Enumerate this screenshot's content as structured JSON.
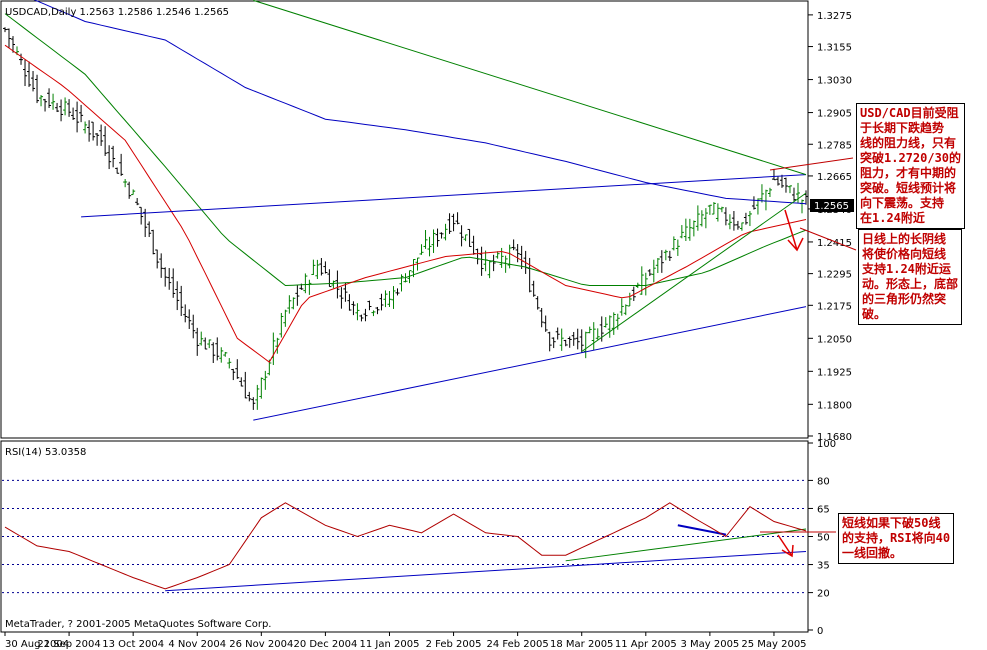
{
  "header": {
    "symbol_line": "USDCAD,Daily  1.2563 1.2586 1.2546 1.2565",
    "rsi_line": "RSI(14) 53.0358",
    "copyright": "MetaTrader, ? 2001-2005 MetaQuotes Software Corp."
  },
  "annotations": {
    "box1": "USD/CAD目前受阻\n于长期下跌趋势\n线的阻力线，只有\n突破1.2720/30的\n阻力，才有中期的\n突破。短线预计将\n向下震荡。支持\n在1.24附近",
    "box2": "日线上的长阴线\n将使价格向短线\n支持1.24附近运\n动。形态上，底部\n的三角形仍然突\n破。",
    "box3": "短线如果下破50线\n的支持，RSI将向40\n一线回撤。"
  },
  "colors": {
    "up_bar": "#008000",
    "down_bar": "#000000",
    "ma_fast": "#d40000",
    "ma_mid": "#008000",
    "ma_slow": "#0000c0",
    "trend_blue": "#0000c0",
    "trend_green": "#008000",
    "rsi_line": "#b00000",
    "arrow": "#e00000",
    "price_tag_bg": "#000000"
  },
  "chart_data": [
    {
      "type": "ohlc",
      "title": "USDCAD,Daily",
      "current_price": "1.2565",
      "ylim": [
        1.168,
        1.332
      ],
      "y_ticks": [
        "1.3275",
        "1.3155",
        "1.3030",
        "1.2905",
        "1.2785",
        "1.2665",
        "1.2540",
        "1.2415",
        "1.2295",
        "1.2175",
        "1.2050",
        "1.1925",
        "1.1800",
        "1.1680"
      ],
      "x_tick_labels": [
        "30 Aug 2004",
        "21 Sep 2004",
        "13 Oct 2004",
        "4 Nov 2004",
        "26 Nov 2004",
        "20 Dec 2004",
        "11 Jan 2005",
        "2 Feb 2005",
        "24 Feb 2005",
        "18 Mar 2005",
        "11 Apr 2005",
        "3 May 2005",
        "25 May 2005"
      ],
      "x_tick_index": [
        0,
        16,
        32,
        48,
        64,
        80,
        96,
        112,
        128,
        144,
        160,
        176,
        192
      ],
      "bar_count": 201,
      "price_path": [
        [
          0,
          1.322
        ],
        [
          8,
          1.297
        ],
        [
          16,
          1.291
        ],
        [
          24,
          1.28
        ],
        [
          32,
          1.259
        ],
        [
          40,
          1.228
        ],
        [
          48,
          1.205
        ],
        [
          56,
          1.196
        ],
        [
          62,
          1.179
        ],
        [
          70,
          1.215
        ],
        [
          78,
          1.233
        ],
        [
          88,
          1.215
        ],
        [
          96,
          1.22
        ],
        [
          104,
          1.238
        ],
        [
          112,
          1.25
        ],
        [
          120,
          1.232
        ],
        [
          128,
          1.238
        ],
        [
          136,
          1.205
        ],
        [
          144,
          1.203
        ],
        [
          152,
          1.213
        ],
        [
          160,
          1.228
        ],
        [
          168,
          1.242
        ],
        [
          176,
          1.254
        ],
        [
          184,
          1.248
        ],
        [
          192,
          1.265
        ],
        [
          200,
          1.2565
        ]
      ],
      "ma_fast": [
        [
          0,
          1.316
        ],
        [
          15,
          1.3
        ],
        [
          30,
          1.28
        ],
        [
          45,
          1.245
        ],
        [
          58,
          1.205
        ],
        [
          66,
          1.196
        ],
        [
          75,
          1.22
        ],
        [
          90,
          1.228
        ],
        [
          110,
          1.236
        ],
        [
          125,
          1.238
        ],
        [
          140,
          1.225
        ],
        [
          155,
          1.22
        ],
        [
          170,
          1.232
        ],
        [
          185,
          1.245
        ],
        [
          200,
          1.25
        ]
      ],
      "ma_mid": [
        [
          0,
          1.328
        ],
        [
          20,
          1.305
        ],
        [
          40,
          1.27
        ],
        [
          55,
          1.243
        ],
        [
          70,
          1.225
        ],
        [
          85,
          1.226
        ],
        [
          100,
          1.228
        ],
        [
          115,
          1.236
        ],
        [
          130,
          1.232
        ],
        [
          145,
          1.225
        ],
        [
          160,
          1.225
        ],
        [
          175,
          1.23
        ],
        [
          190,
          1.24
        ],
        [
          200,
          1.246
        ]
      ],
      "ma_slow": [
        [
          0,
          1.338
        ],
        [
          20,
          1.325
        ],
        [
          40,
          1.318
        ],
        [
          60,
          1.3
        ],
        [
          80,
          1.288
        ],
        [
          100,
          1.284
        ],
        [
          120,
          1.279
        ],
        [
          140,
          1.272
        ],
        [
          160,
          1.264
        ],
        [
          180,
          1.258
        ],
        [
          200,
          1.256
        ]
      ],
      "trendlines": [
        {
          "color": "blue",
          "points": [
            [
              19,
              1.251
            ],
            [
              200,
              1.267
            ]
          ]
        },
        {
          "color": "blue",
          "points": [
            [
              62,
              1.174
            ],
            [
              200,
              1.217
            ]
          ]
        },
        {
          "color": "green",
          "points": [
            [
              62,
              1.333
            ],
            [
              200,
              1.267
            ]
          ]
        },
        {
          "color": "green",
          "points": [
            [
              144,
              1.2
            ],
            [
              200,
              1.26
            ]
          ]
        }
      ]
    },
    {
      "type": "line",
      "title": "RSI(14) 53.0358",
      "ylim": [
        0,
        100
      ],
      "y_ticks": [
        "100",
        "80",
        "65",
        "50",
        "35",
        "20",
        "0"
      ],
      "levels": [
        20,
        35,
        50,
        65,
        80
      ],
      "rsi_path": [
        [
          0,
          55
        ],
        [
          8,
          45
        ],
        [
          16,
          42
        ],
        [
          24,
          35
        ],
        [
          32,
          28
        ],
        [
          40,
          22
        ],
        [
          48,
          28
        ],
        [
          56,
          35
        ],
        [
          64,
          60
        ],
        [
          70,
          68
        ],
        [
          80,
          56
        ],
        [
          88,
          50
        ],
        [
          96,
          56
        ],
        [
          104,
          52
        ],
        [
          112,
          62
        ],
        [
          120,
          52
        ],
        [
          128,
          50
        ],
        [
          134,
          40
        ],
        [
          140,
          40
        ],
        [
          146,
          46
        ],
        [
          152,
          52
        ],
        [
          160,
          60
        ],
        [
          166,
          68
        ],
        [
          172,
          60
        ],
        [
          180,
          50
        ],
        [
          186,
          66
        ],
        [
          192,
          58
        ],
        [
          200,
          53
        ]
      ],
      "trendlines": [
        {
          "color": "blue",
          "points": [
            [
              40,
              21
            ],
            [
              200,
              42
            ]
          ]
        },
        {
          "color": "green",
          "points": [
            [
              140,
              37
            ],
            [
              200,
              54
            ]
          ]
        },
        {
          "color": "blue",
          "points": [
            [
              168,
              56
            ],
            [
              180,
              51
            ]
          ]
        }
      ]
    }
  ]
}
